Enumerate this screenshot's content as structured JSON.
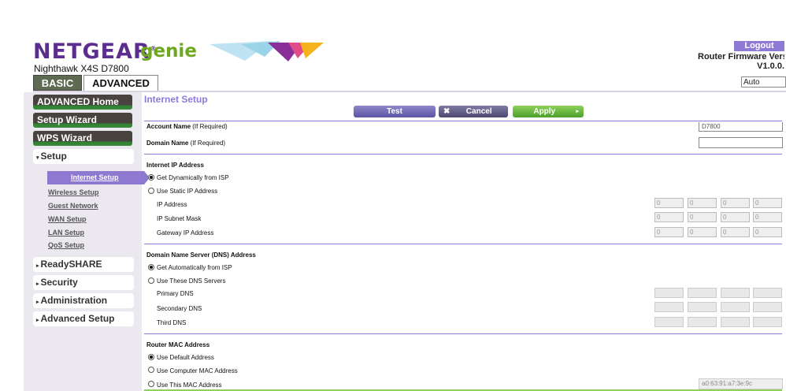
{
  "header": {
    "brand": "NETGEAR",
    "brand_mark": "®",
    "product": "genie",
    "model": "Nighthawk X4S D7800",
    "logout": "Logout",
    "firmware_label": "Router Firmware Versi",
    "firmware_version": "V1.0.0.",
    "language": "Auto"
  },
  "tabs": {
    "basic": "BASIC",
    "advanced": "ADVANCED"
  },
  "sidebar": {
    "advanced_home": "ADVANCED Home",
    "setup_wizard": "Setup Wizard",
    "wps_wizard": "WPS Wizard",
    "setup": "Setup",
    "setup_items": [
      "Internet Setup",
      "Wireless Setup",
      "Guest Network",
      "WAN Setup",
      "LAN Setup",
      "QoS Setup"
    ],
    "readyshare": "ReadySHARE",
    "security": "Security",
    "administration": "Administration",
    "advanced_setup": "Advanced Setup"
  },
  "main": {
    "title": "Internet Setup",
    "buttons": {
      "test": "Test",
      "cancel": "Cancel",
      "apply": "Apply"
    },
    "account_name_label": "Account Name",
    "account_name_hint": "(If Required)",
    "account_name_value": "D7800",
    "domain_name_label": "Domain Name",
    "domain_name_hint": "(If Required)",
    "ip_section": {
      "title": "Internet IP Address",
      "opt_dynamic": "Get Dynamically from ISP",
      "opt_static": "Use Static IP Address",
      "ip_label": "IP Address",
      "mask_label": "IP Subnet Mask",
      "gateway_label": "Gateway IP Address",
      "ip_values": [
        "0",
        "0",
        "0",
        "0"
      ],
      "mask_values": [
        "0",
        "0",
        "0",
        "0"
      ],
      "gateway_values": [
        "0",
        "0",
        "0",
        "0"
      ]
    },
    "dns_section": {
      "title": "Domain Name Server (DNS) Address",
      "opt_auto": "Get Automatically from ISP",
      "opt_manual": "Use These DNS Servers",
      "primary": "Primary DNS",
      "secondary": "Secondary DNS",
      "third": "Third DNS"
    },
    "mac_section": {
      "title": "Router MAC Address",
      "opt_default": "Use Default Address",
      "opt_computer": "Use Computer MAC Address",
      "opt_this": "Use This MAC Address",
      "mac_value": "a0:63:91:a7:3e:9c"
    }
  },
  "colors": {
    "accent": "#8e7ad6",
    "brand": "#5b2d8e",
    "genie": "#6ea81f",
    "apply": "#5cb236"
  }
}
